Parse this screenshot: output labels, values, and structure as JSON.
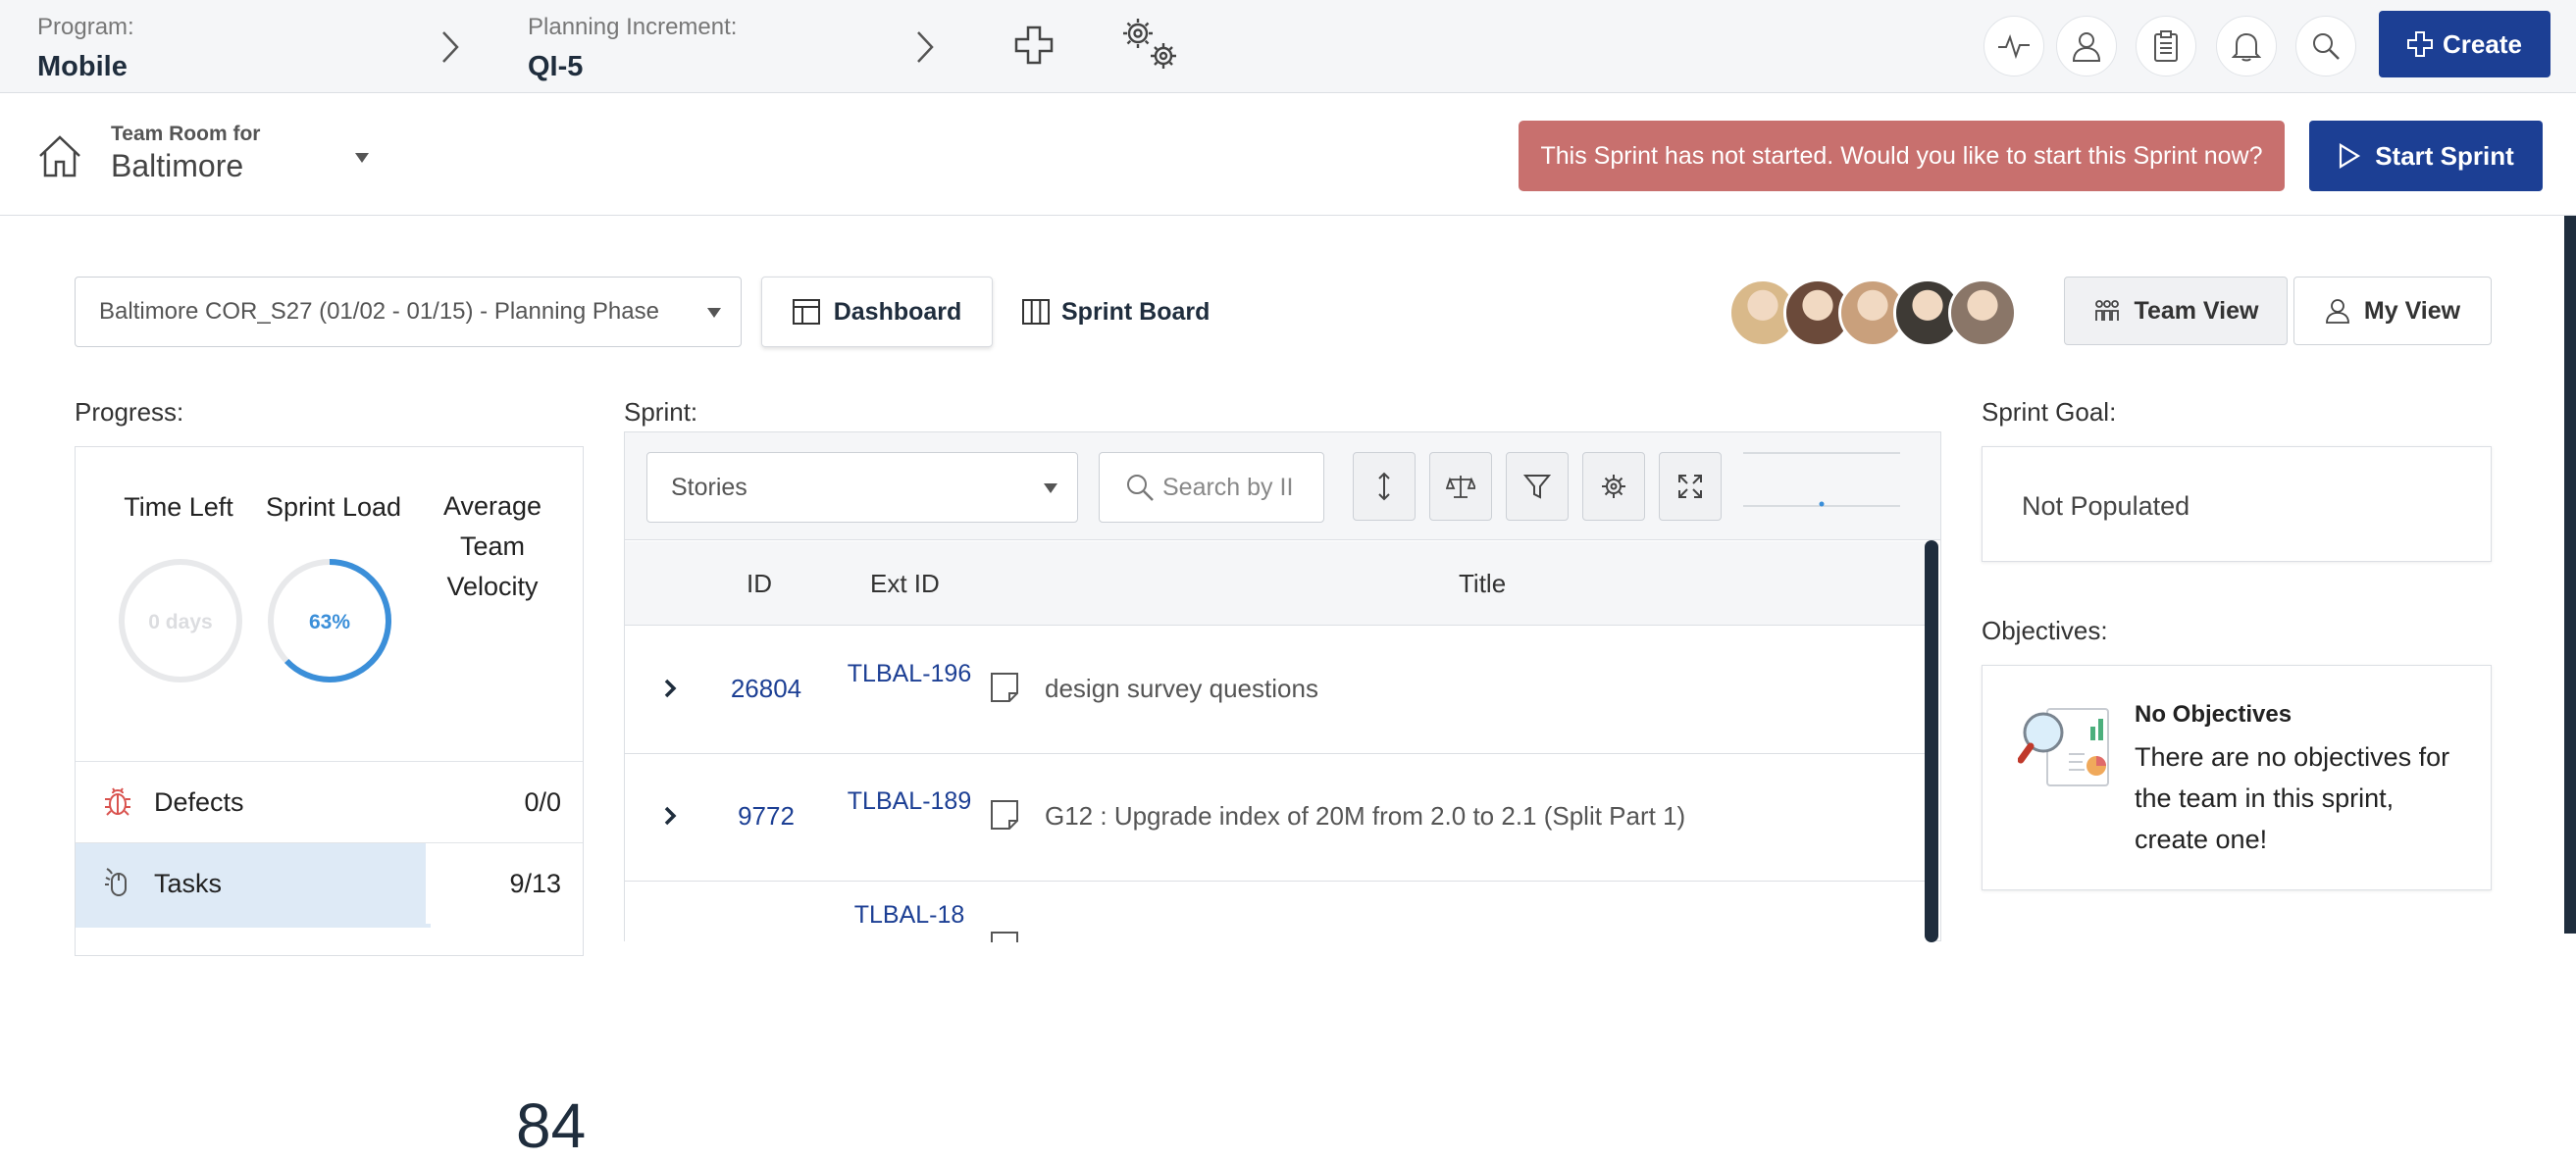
{
  "topbar": {
    "program_label": "Program:",
    "program_value": "Mobile",
    "pi_label": "Planning Increment:",
    "pi_value": "QI-5",
    "create_label": "Create",
    "icons": [
      "activity-icon",
      "user-icon",
      "clipboard-icon",
      "bell-icon",
      "search-icon"
    ]
  },
  "teamroom": {
    "label": "Team Room for",
    "value": "Baltimore",
    "alert": "This Sprint has not started. Would you like to start this Sprint now?",
    "start_label": "Start Sprint"
  },
  "controls": {
    "sprint_selected": "Baltimore COR_S27 (01/02 - 01/15) - Planning Phase",
    "dashboard_label": "Dashboard",
    "sprint_board_label": "Sprint Board",
    "team_view_label": "Team View",
    "my_view_label": "My View",
    "avatar_colors": [
      "#d9b98a",
      "#6b4a3a",
      "#c9a07c",
      "#3e3a35",
      "#8a7668"
    ]
  },
  "progress": {
    "title": "Progress:",
    "time_left_label": "Time Left",
    "time_left_value": "0 days",
    "sprint_load_label": "Sprint Load",
    "sprint_load_value": "63%",
    "sprint_load_fraction": 0.63,
    "velocity_label_1": "Average",
    "velocity_label_2": "Team",
    "velocity_label_3": "Velocity",
    "velocity_value": "84",
    "rows": [
      {
        "name": "Defects",
        "value": "0/0"
      },
      {
        "name": "Tasks",
        "value": "9/13",
        "fill_fraction": 0.69
      }
    ]
  },
  "sprint": {
    "title": "Sprint:",
    "filter_selected": "Stories",
    "search_placeholder": "Search by II",
    "columns": [
      "ID",
      "Ext ID",
      "Title"
    ],
    "rows": [
      {
        "id": "26804",
        "ext_id": "TLBAL-196",
        "title": "design survey questions"
      },
      {
        "id": "9772",
        "ext_id": "TLBAL-189",
        "title": "G12 : Upgrade index of 20M from 2.0 to 2.1 (Split Part 1)"
      },
      {
        "id": "",
        "ext_id": "TLBAL-18",
        "title": ""
      }
    ]
  },
  "goal": {
    "title": "Sprint Goal:",
    "value": "Not Populated"
  },
  "objectives": {
    "title": "Objectives:",
    "empty_title": "No Objectives",
    "empty_desc": "There are no objectives for the team in this sprint, create one!"
  },
  "colors": {
    "primary": "#1c3f94",
    "alert": "#c8706e",
    "progress_ring": "#3b8fd9",
    "tasks_fill": "#deeaf6"
  }
}
